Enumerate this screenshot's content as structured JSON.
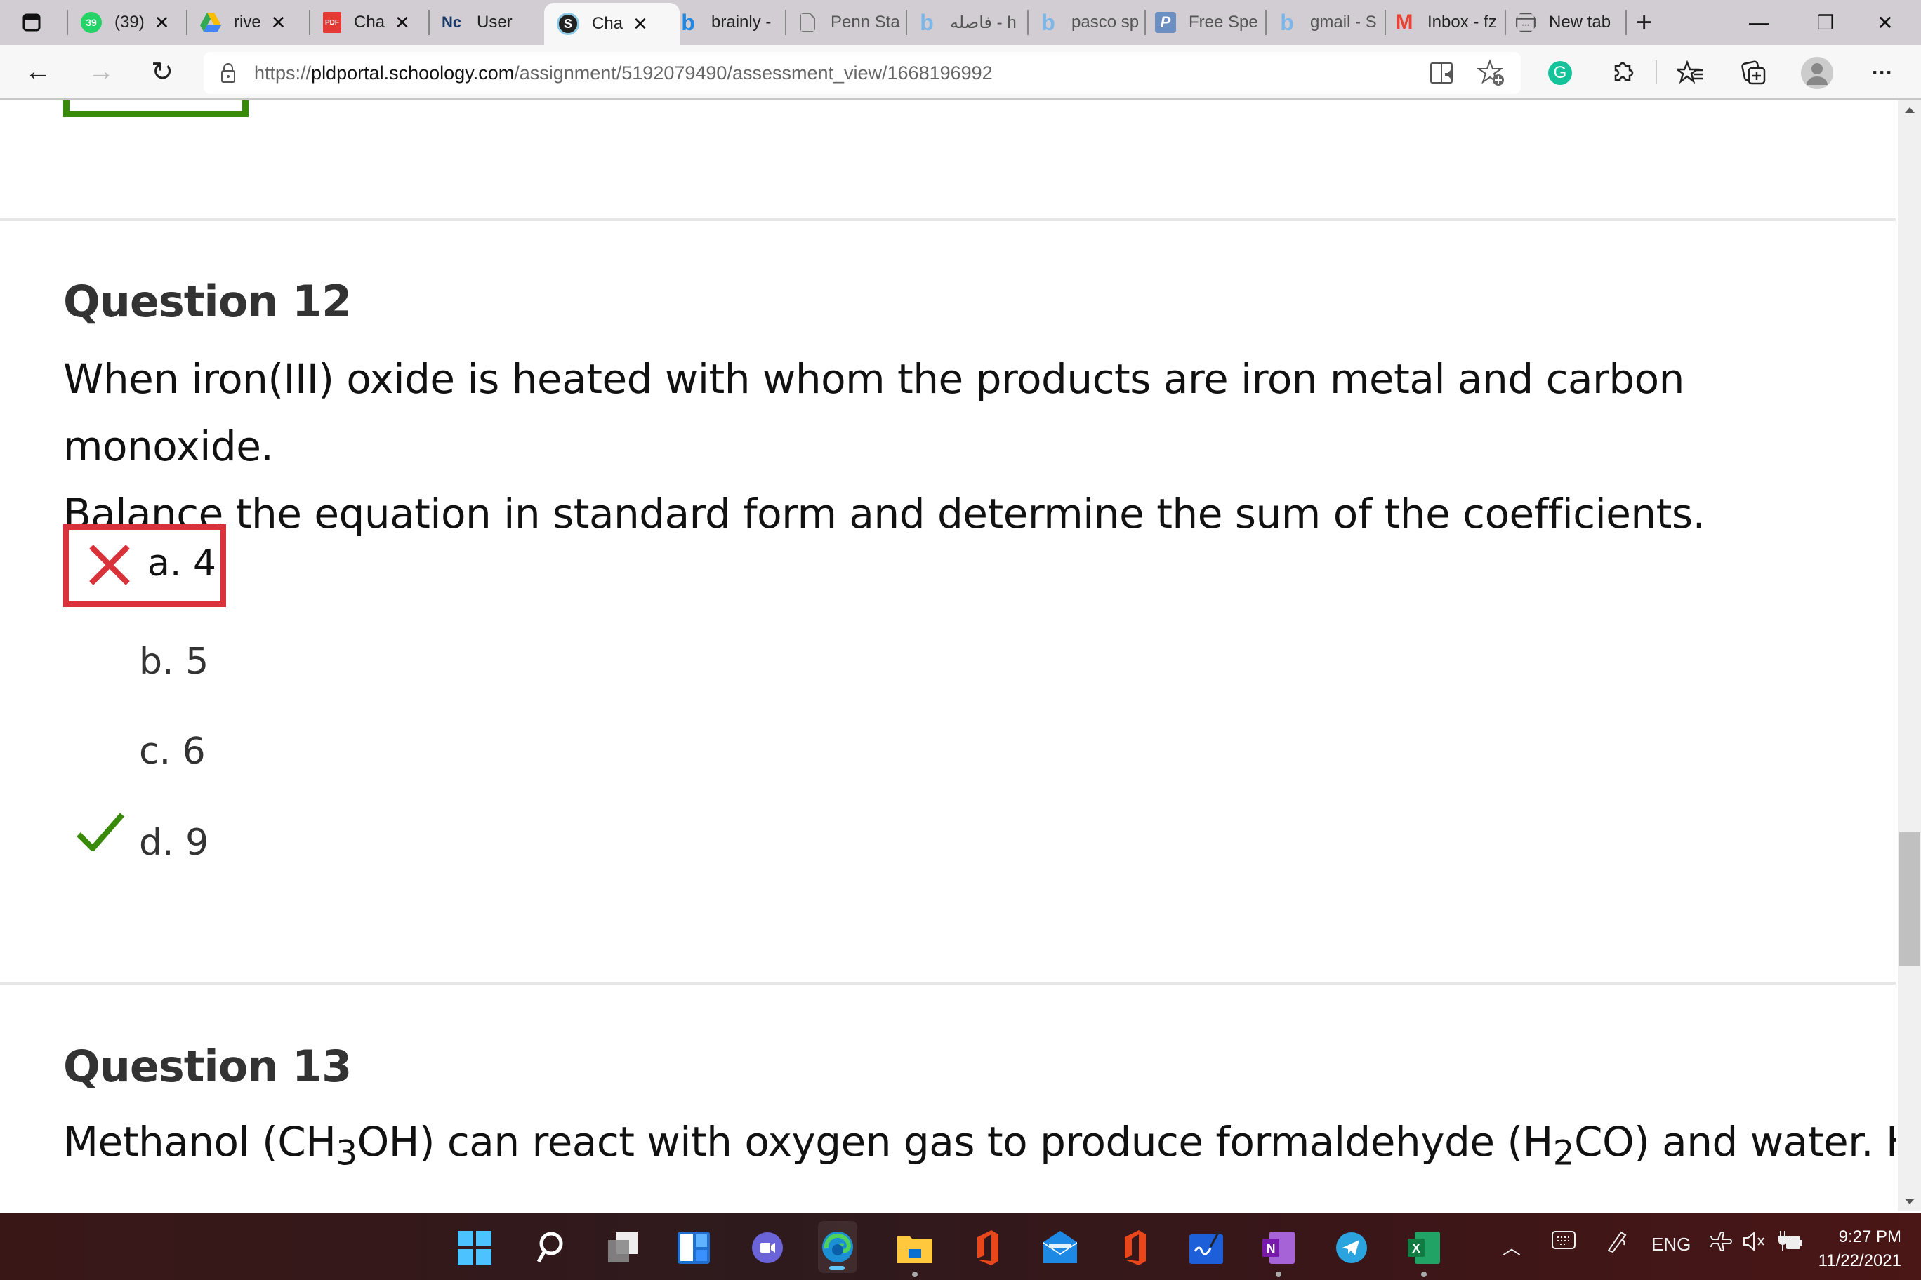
{
  "browser": {
    "tabs": [
      {
        "label": "(39)",
        "icon": "whatsapp-icon",
        "badge": "39",
        "closable": true
      },
      {
        "label": "rive",
        "icon": "google-drive-icon",
        "closable": true
      },
      {
        "label": "Cha",
        "icon": "pdf-icon",
        "icon_text": "PDF",
        "closable": true
      },
      {
        "label": "User",
        "icon": "nc-logo-icon",
        "icon_text": "Nc",
        "closable": false
      },
      {
        "label": "Cha",
        "icon": "schoology-icon",
        "icon_text": "S",
        "closable": true,
        "active": true
      },
      {
        "label": "brainly -",
        "icon": "bing-icon",
        "closable": false
      },
      {
        "label": "Penn Sta",
        "icon": "page-icon",
        "closable": false
      },
      {
        "label": "فاصله - h",
        "icon": "bing-icon",
        "closable": false
      },
      {
        "label": "pasco sp",
        "icon": "bing-icon",
        "closable": false
      },
      {
        "label": "Free Spe",
        "icon": "p-logo-icon",
        "icon_text": "P",
        "closable": false
      },
      {
        "label": "gmail - S",
        "icon": "bing-icon",
        "closable": false
      },
      {
        "label": "Inbox - fz",
        "icon": "gmail-icon",
        "icon_text": "M",
        "closable": false
      },
      {
        "label": "New tab",
        "icon": "new-tab-page-icon",
        "closable": false
      }
    ],
    "new_tab_symbol": "+",
    "window_controls": {
      "minimize": "—",
      "restore": "❐",
      "close": "✕"
    },
    "address": {
      "url_scheme": "https://",
      "url_host": "pldportal.schoology.com",
      "url_path": "/assignment/5192079490/assessment_view/1668196992"
    },
    "toolbar": {
      "more_label": "···",
      "grammarly_letter": "G"
    }
  },
  "page": {
    "questions": [
      {
        "title": "Question 12",
        "text_line1": "When iron(III) oxide is heated with whom the products are iron metal and carbon monoxide.",
        "text_line2": "Balance the equation in standard form and determine the sum of the coefficients.",
        "choices": [
          {
            "label": "a. 4",
            "status": "selected-incorrect"
          },
          {
            "label": "b. 5",
            "status": "none"
          },
          {
            "label": "c. 6",
            "status": "none"
          },
          {
            "label": "d. 9",
            "status": "correct"
          }
        ]
      },
      {
        "title": "Question 13",
        "text_part1": "Methanol (CH",
        "sub1": "3",
        "text_part2": "OH) can react with oxygen gas to produce formaldehyde (H",
        "sub2": "2",
        "text_part3": "CO) and water. Ho"
      }
    ],
    "colors": {
      "incorrect": "#d9323a",
      "correct": "#3a8a0a"
    }
  },
  "taskbar": {
    "apps": [
      "windows-start",
      "search",
      "task-view",
      "widgets",
      "teams-chat",
      "edge",
      "file-explorer",
      "office",
      "mail",
      "office-2",
      "whiteboard",
      "onenote",
      "telegram",
      "excel"
    ],
    "tray": {
      "language": "ENG",
      "time": "9:27 PM",
      "date": "11/22/2021"
    }
  }
}
